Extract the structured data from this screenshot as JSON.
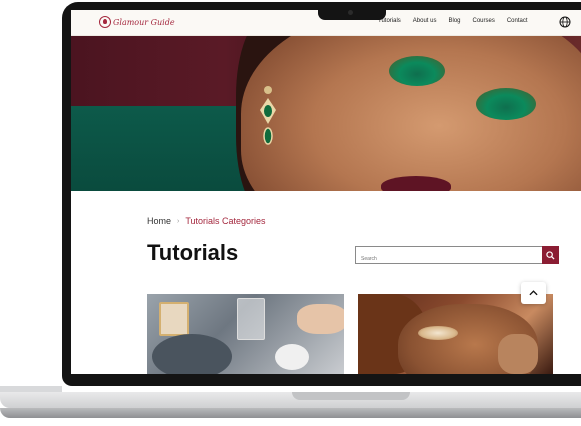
{
  "site": {
    "logo_text": "Glamour Guide",
    "nav": [
      {
        "label": "Tutorials"
      },
      {
        "label": "About us"
      },
      {
        "label": "Blog"
      },
      {
        "label": "Courses"
      },
      {
        "label": "Contact"
      }
    ],
    "globe_icon": "globe-icon"
  },
  "breadcrumb": {
    "home": "Home",
    "separator": "›",
    "current": "Tutorials Categories"
  },
  "page": {
    "title": "Tutorials"
  },
  "search": {
    "placeholder": "Search",
    "button_icon": "search-icon"
  },
  "colors": {
    "accent": "#8b1d33",
    "breadcrumb_active": "#a4283e"
  },
  "scroll_top_icon": "chevron-up-icon"
}
